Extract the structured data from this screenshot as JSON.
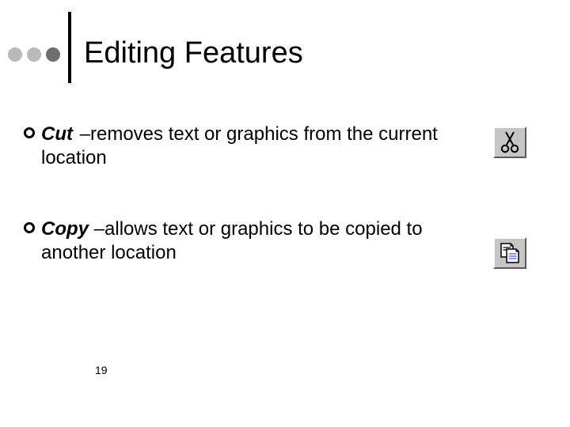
{
  "header": {
    "title": "Editing Features"
  },
  "bullets": [
    {
      "term": "Cut",
      "desc": " –removes text or graphics from the current location"
    },
    {
      "term": "Copy",
      "desc": " –allows text or graphics to be copied to another location"
    }
  ],
  "icons": {
    "cut": "scissors-icon",
    "copy": "copy-pages-icon"
  },
  "page_number": "19"
}
